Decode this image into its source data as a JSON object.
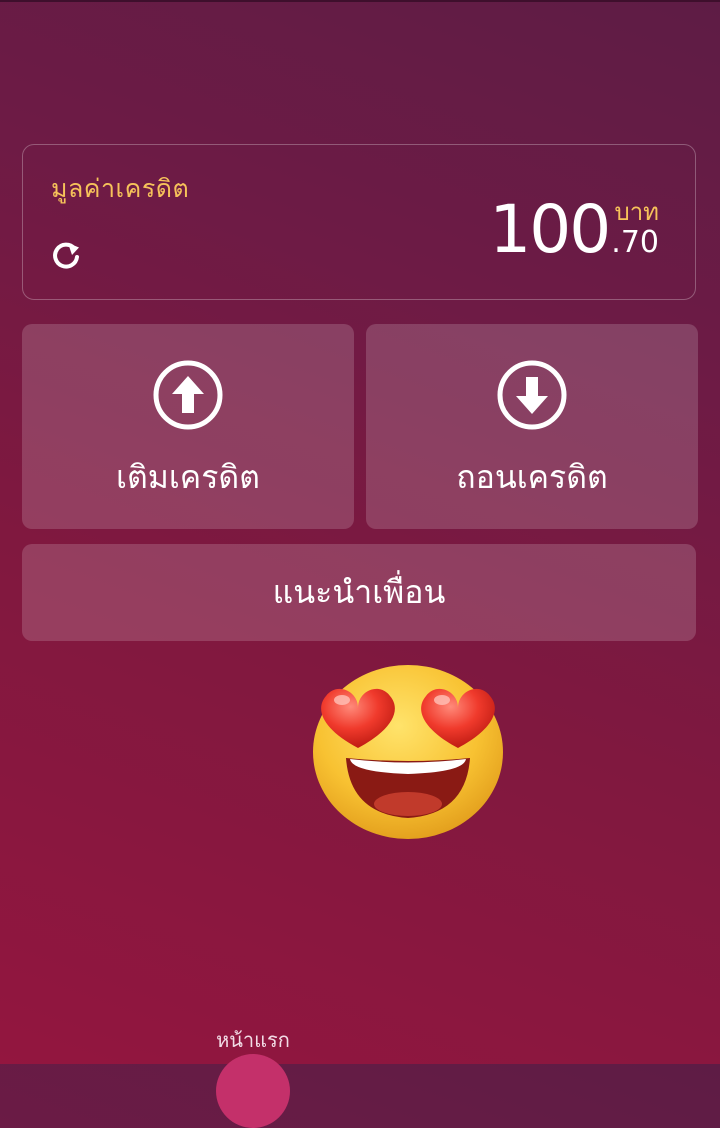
{
  "credit": {
    "label": "มูลค่าเครดิต",
    "amount_integer": "100",
    "amount_decimal": ".70",
    "currency": "บาท",
    "refresh_icon": "refresh-icon"
  },
  "actions": {
    "deposit": {
      "label": "เติมเครดิต",
      "icon": "arrow-up-circle-icon"
    },
    "withdraw": {
      "label": "ถอนเครดิต",
      "icon": "arrow-down-circle-icon"
    },
    "invite": {
      "label": "แนะนำเพื่อน"
    }
  },
  "sticker": {
    "icon": "heart-eyes-emoji"
  },
  "bottom_nav": {
    "home_label": "หน้าแรก"
  },
  "colors": {
    "accent": "#f6c25a",
    "button_fill": "#9a3a6b",
    "background_top": "#5e1c45",
    "background_bottom": "#93163f",
    "nav_active": "#c4306a"
  }
}
